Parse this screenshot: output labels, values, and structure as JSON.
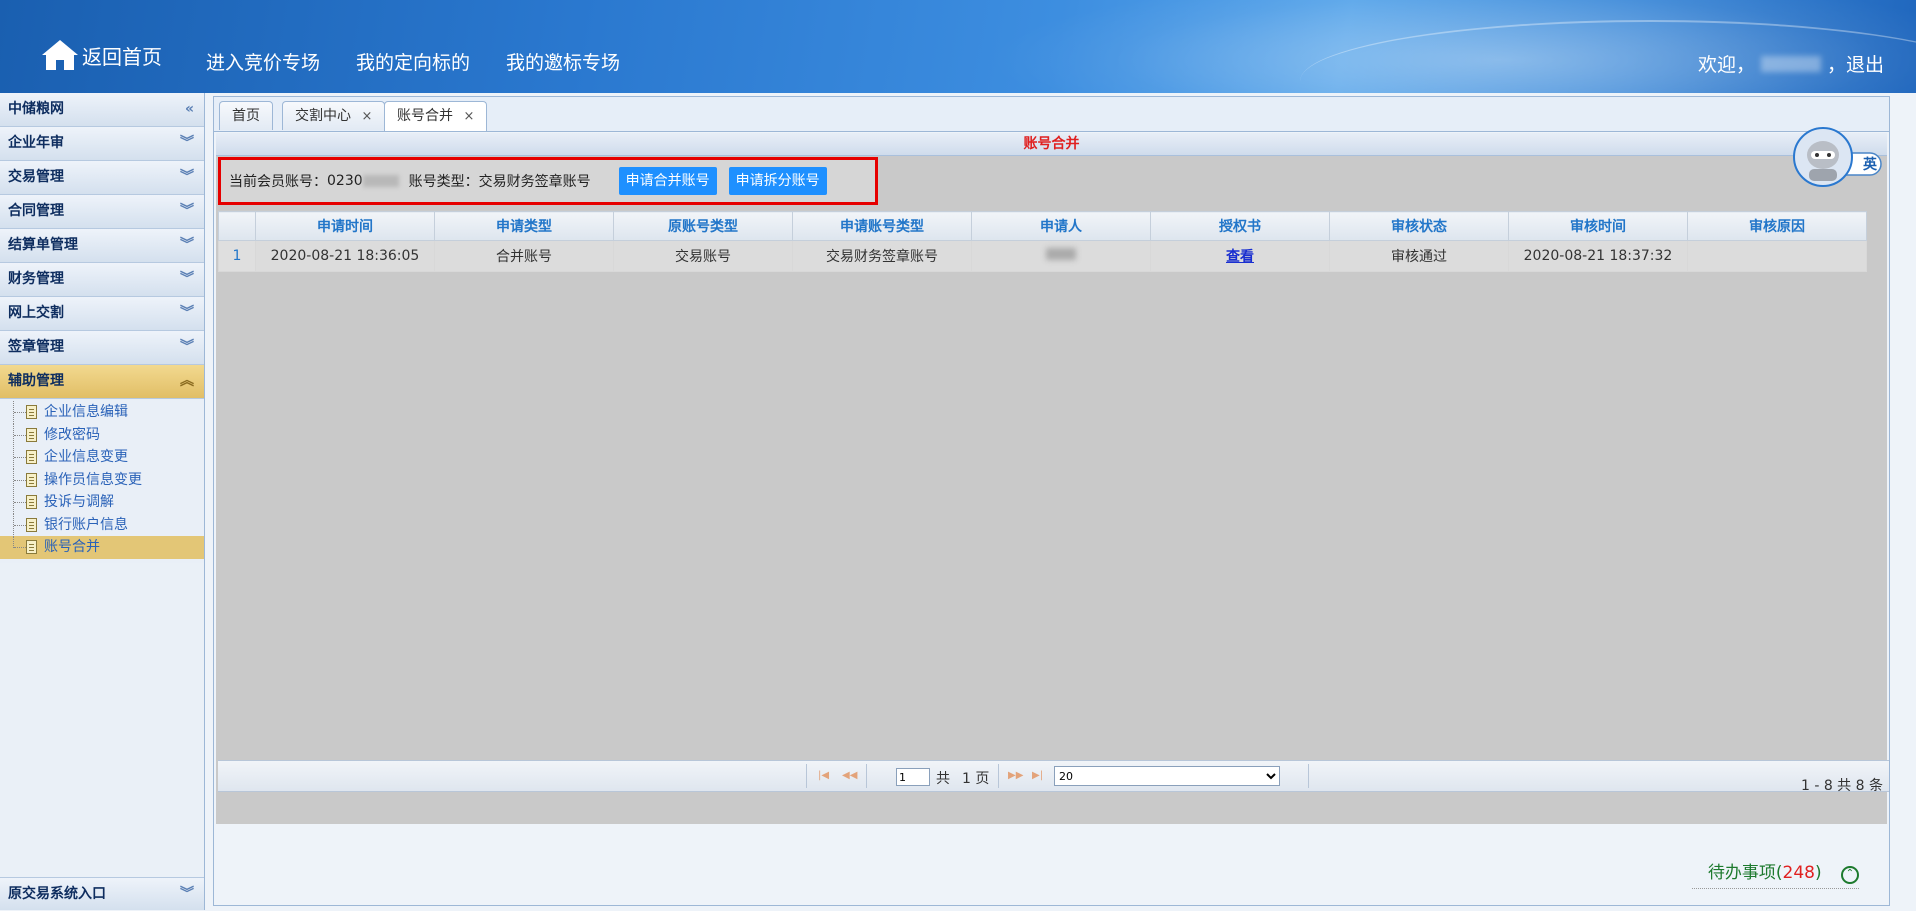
{
  "header": {
    "home_label": "返回首页",
    "nav": [
      "进入竞价专场",
      "我的定向标的",
      "我的邀标专场"
    ],
    "welcome_prefix": "欢迎，",
    "logout": "，退出"
  },
  "sidebar": {
    "items": [
      {
        "label": "中储粮网",
        "chevron": "«"
      },
      {
        "label": "企业年审",
        "chevron": "︾"
      },
      {
        "label": "交易管理",
        "chevron": "︾"
      },
      {
        "label": "合同管理",
        "chevron": "︾"
      },
      {
        "label": "结算单管理",
        "chevron": "︾"
      },
      {
        "label": "财务管理",
        "chevron": "︾"
      },
      {
        "label": "网上交割",
        "chevron": "︾"
      },
      {
        "label": "签章管理",
        "chevron": "︾"
      },
      {
        "label": "辅助管理",
        "chevron": "︽"
      }
    ],
    "sub_items": [
      "企业信息编辑",
      "修改密码",
      "企业信息变更",
      "操作员信息变更",
      "投诉与调解",
      "银行账户信息",
      "账号合并"
    ],
    "bottom": {
      "label": "原交易系统入口",
      "chevron": "︾"
    }
  },
  "tabs": [
    {
      "label": "首页"
    },
    {
      "label": "交割中心",
      "close": "×"
    },
    {
      "label": "账号合并",
      "close": "×"
    }
  ],
  "panel": {
    "title": "账号合并"
  },
  "toolbar": {
    "account_label": "当前会员账号：",
    "account_value": "0230",
    "type_label": "账号类型：",
    "type_value": "交易财务签章账号",
    "btn_merge": "申请合并账号",
    "btn_split": "申请拆分账号"
  },
  "table": {
    "columns": [
      "申请时间",
      "申请类型",
      "原账号类型",
      "申请账号类型",
      "申请人",
      "授权书",
      "审核状态",
      "审核时间",
      "审核原因"
    ],
    "rows": [
      {
        "num": "1",
        "apply_time": "2020-08-21 18:36:05",
        "apply_type": "合并账号",
        "orig_type": "交易账号",
        "apply_account_type": "交易财务签章账号",
        "applicant": "",
        "auth": "查看",
        "status": "审核通过",
        "review_time": "2020-08-21 18:37:32",
        "reason": ""
      }
    ]
  },
  "pager": {
    "page_value": "1",
    "total_prefix": "共",
    "total_pages": "1 页",
    "page_size": "20",
    "summary": "1 - 8    共 8 条"
  },
  "float": {
    "lang": "英"
  },
  "todo": {
    "label": "待办事项",
    "open": "(",
    "count": "248",
    "close": ")"
  },
  "colors": {
    "header": "#2a78cf",
    "active_menu": "#e1be66",
    "highlight_border": "#e60000",
    "button": "#1e90ff"
  }
}
